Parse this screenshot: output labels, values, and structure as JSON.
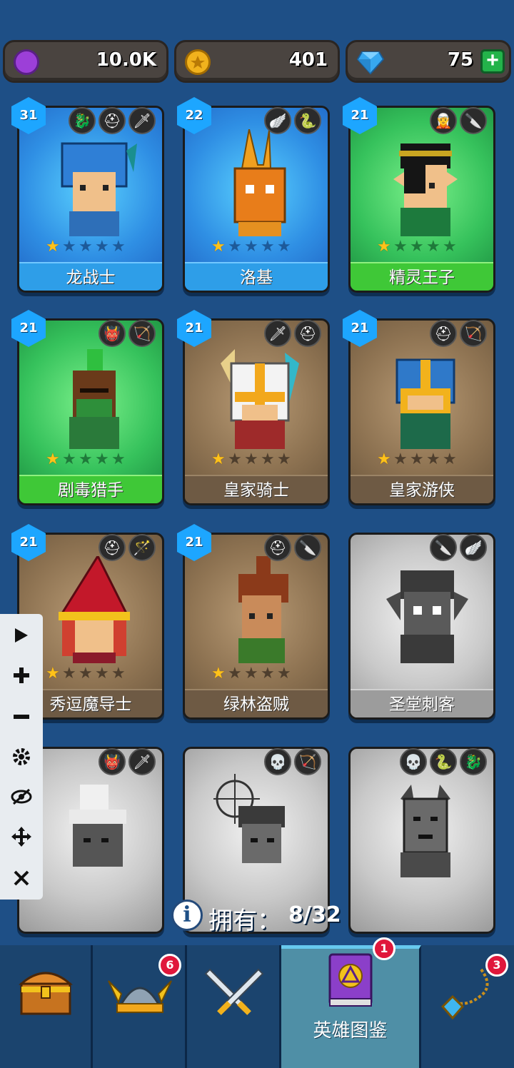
{
  "resources": {
    "elixir": {
      "value": "10.0K",
      "icon": "purple-coin-icon",
      "color": "#9c3fd8"
    },
    "gold": {
      "value": "401",
      "icon": "gold-coin-icon",
      "color": "#f1b21d"
    },
    "gems": {
      "value": "75",
      "icon": "diamond-icon",
      "color": "#37a8f0",
      "plus": "+"
    }
  },
  "heroes": [
    {
      "name": "龙战士",
      "level": "31",
      "stars": 1,
      "theme": "blue",
      "roles": [
        "dragon-icon",
        "helmet-icon",
        "sword-icon"
      ]
    },
    {
      "name": "洛基",
      "level": "22",
      "stars": 1,
      "theme": "blue",
      "roles": [
        "wing-helmet-icon",
        "serpent-icon"
      ]
    },
    {
      "name": "精灵王子",
      "level": "21",
      "stars": 1,
      "theme": "green",
      "roles": [
        "elf-icon",
        "dagger-icon"
      ]
    },
    {
      "name": "剧毒猎手",
      "level": "21",
      "stars": 1,
      "theme": "green",
      "roles": [
        "orc-icon",
        "bow-icon"
      ]
    },
    {
      "name": "皇家骑士",
      "level": "21",
      "stars": 1,
      "theme": "brown",
      "roles": [
        "sword-icon",
        "helmet-icon"
      ]
    },
    {
      "name": "皇家游侠",
      "level": "21",
      "stars": 1,
      "theme": "brown",
      "roles": [
        "helmet-icon",
        "bow-icon"
      ]
    },
    {
      "name": "秀逗魔导士",
      "level": "21",
      "stars": 1,
      "theme": "brown",
      "roles": [
        "helmet-icon",
        "staff-icon"
      ]
    },
    {
      "name": "绿林盗贼",
      "level": "21",
      "stars": 1,
      "theme": "brown",
      "roles": [
        "helmet-icon",
        "dagger-icon"
      ]
    },
    {
      "name": "圣堂刺客",
      "level": "",
      "stars": 0,
      "theme": "gray",
      "roles": [
        "dagger-icon",
        "wing-helmet-icon"
      ]
    },
    {
      "name": "",
      "level": "",
      "stars": 0,
      "theme": "gray",
      "roles": [
        "orc-icon",
        "sword-icon"
      ]
    },
    {
      "name": "",
      "level": "",
      "stars": 0,
      "theme": "gray",
      "roles": [
        "skull-icon",
        "bow-icon"
      ]
    },
    {
      "name": "",
      "level": "",
      "stars": 0,
      "theme": "gray",
      "roles": [
        "skull-icon",
        "serpent-icon",
        "dragon-icon"
      ]
    }
  ],
  "ownership": {
    "label": "拥有：",
    "value": "8/32"
  },
  "nav": [
    {
      "id": "chest",
      "label": "",
      "badge": "",
      "icon": "treasure-chest-icon"
    },
    {
      "id": "heroes",
      "label": "",
      "badge": "6",
      "icon": "viking-helmet-icon"
    },
    {
      "id": "battle",
      "label": "",
      "badge": "",
      "icon": "crossed-swords-icon"
    },
    {
      "id": "codex",
      "label": "英雄图鉴",
      "badge": "1",
      "icon": "spellbook-icon"
    },
    {
      "id": "amulet",
      "label": "",
      "badge": "3",
      "icon": "amulet-icon"
    }
  ],
  "tools": [
    "play-icon",
    "plus-icon",
    "minus-icon",
    "gear-icon",
    "eye-off-icon",
    "move-icon",
    "close-icon"
  ]
}
